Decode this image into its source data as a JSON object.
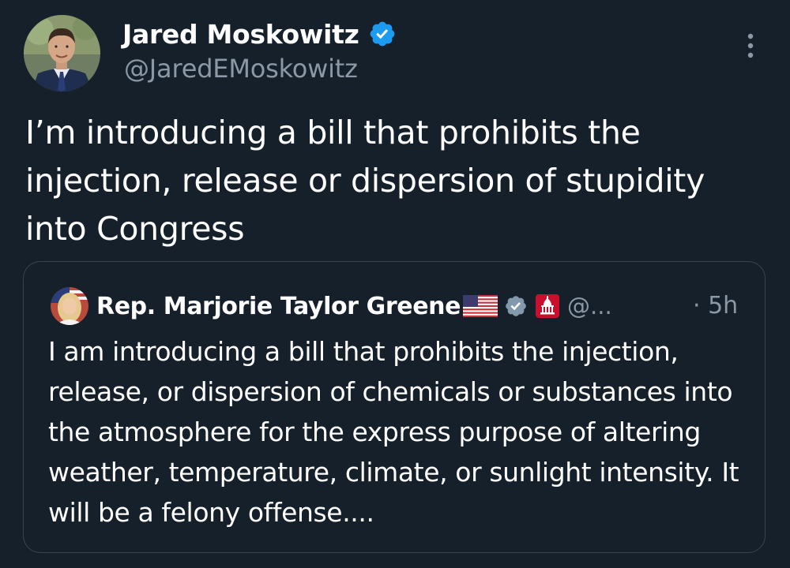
{
  "tweet": {
    "author": {
      "display_name": "Jared Moskowitz",
      "handle": "@JaredEMoskowitz",
      "verified": true,
      "avatar_icon": "profile-photo"
    },
    "more_icon": "more-vertical-icon",
    "text": "I’m introducing a bill that prohibits the injection, release or dispersion of stupidity into Congress"
  },
  "quoted_tweet": {
    "author": {
      "display_name": "Rep. Marjorie Taylor Greene",
      "flag_icon": "us-flag-icon",
      "verified_badge": "gray-verified-icon",
      "affiliate_badge": "capitol-icon",
      "handle": "@..."
    },
    "timestamp": "· 5h",
    "text": "I am introducing a bill that prohibits the injection, release, or dispersion of chemicals or substances into the atmosphere for the express purpose of altering weather, temperature, climate, or sunlight intensity. It will be a felony offense...."
  },
  "colors": {
    "background": "#15202b",
    "text_primary": "#ffffff",
    "text_secondary": "#8b98a5",
    "verified_blue": "#1d9bf0",
    "border": "#38444d"
  }
}
